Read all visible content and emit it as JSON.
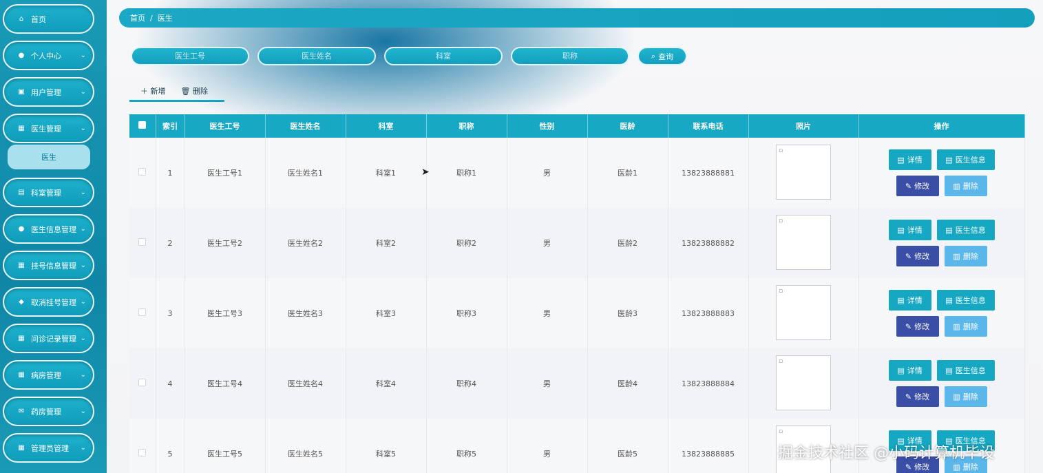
{
  "sidebar": {
    "items": [
      {
        "label": "首页",
        "icon": "home-icon",
        "glyph": "⌂",
        "chevron": false
      },
      {
        "label": "个人中心",
        "icon": "user-icon",
        "glyph": "●",
        "chevron": true
      },
      {
        "label": "用户管理",
        "icon": "briefcase-icon",
        "glyph": "▣",
        "chevron": true
      },
      {
        "label": "医生管理",
        "icon": "grid-icon",
        "glyph": "▦",
        "chevron": true
      },
      {
        "label": "科室管理",
        "icon": "clipboard-icon",
        "glyph": "▤",
        "chevron": true
      },
      {
        "label": "医生信息管理",
        "icon": "user-icon",
        "glyph": "●",
        "chevron": true
      },
      {
        "label": "挂号信息管理",
        "icon": "grid-icon",
        "glyph": "▦",
        "chevron": true
      },
      {
        "label": "取消挂号管理",
        "icon": "thumb-icon",
        "glyph": "◆",
        "chevron": true
      },
      {
        "label": "问诊记录管理",
        "icon": "grid-icon",
        "glyph": "▦",
        "chevron": true
      },
      {
        "label": "病房管理",
        "icon": "grid-icon",
        "glyph": "▦",
        "chevron": true
      },
      {
        "label": "药房管理",
        "icon": "mail-icon",
        "glyph": "✉",
        "chevron": true
      },
      {
        "label": "管理员管理",
        "icon": "grid-icon",
        "glyph": "▦",
        "chevron": true
      }
    ],
    "submenu_doctor": "医生"
  },
  "breadcrumb": {
    "home": "首页",
    "separator": "/",
    "current": "医生"
  },
  "search": {
    "doctor_id_placeholder": "医生工号",
    "doctor_name_placeholder": "医生姓名",
    "department_placeholder": "科室",
    "title_placeholder": "职称",
    "query_label": "查询"
  },
  "actions": {
    "add_label": "新增",
    "delete_label": "删除"
  },
  "table": {
    "headers": [
      "索引",
      "医生工号",
      "医生姓名",
      "科室",
      "职称",
      "性别",
      "医龄",
      "联系电话",
      "照片",
      "操作"
    ],
    "rows": [
      {
        "index": "1",
        "doctor_id": "医生工号1",
        "name": "医生姓名1",
        "department": "科室1",
        "title": "职称1",
        "gender": "男",
        "seniority": "医龄1",
        "phone": "13823888881"
      },
      {
        "index": "2",
        "doctor_id": "医生工号2",
        "name": "医生姓名2",
        "department": "科室2",
        "title": "职称2",
        "gender": "男",
        "seniority": "医龄2",
        "phone": "13823888882"
      },
      {
        "index": "3",
        "doctor_id": "医生工号3",
        "name": "医生姓名3",
        "department": "科室3",
        "title": "职称3",
        "gender": "男",
        "seniority": "医龄3",
        "phone": "13823888883"
      },
      {
        "index": "4",
        "doctor_id": "医生工号4",
        "name": "医生姓名4",
        "department": "科室4",
        "title": "职称4",
        "gender": "男",
        "seniority": "医龄4",
        "phone": "13823888884"
      },
      {
        "index": "5",
        "doctor_id": "医生工号5",
        "name": "医生姓名5",
        "department": "科室5",
        "title": "职称5",
        "gender": "男",
        "seniority": "医龄5",
        "phone": "13823888885"
      }
    ],
    "row_buttons": {
      "detail": "详情",
      "doctor_info": "医生信息",
      "edit": "修改",
      "delete": "删除"
    }
  },
  "watermark": "掘金技术社区 @小码计算机毕设"
}
